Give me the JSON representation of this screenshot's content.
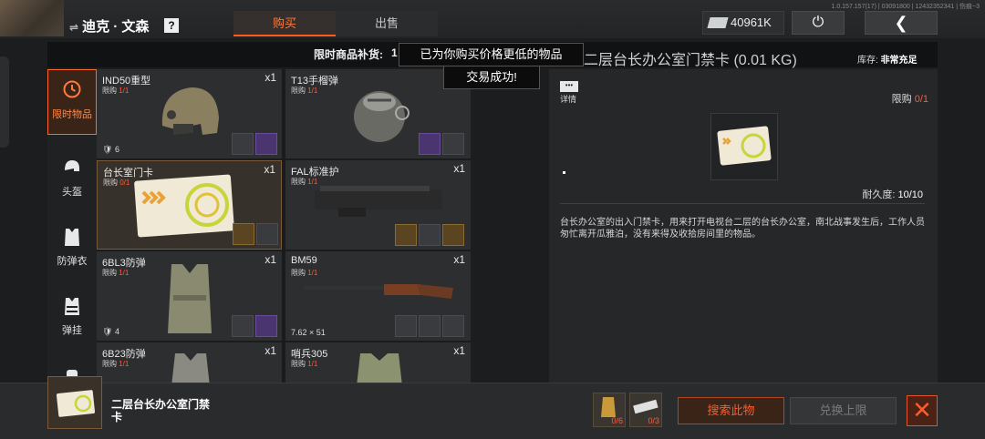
{
  "player": {
    "name": "迪克 · 文森",
    "name_mark": "⇌",
    "help": "?"
  },
  "tabs": {
    "buy": "购买",
    "sell": "出售"
  },
  "version_text": "1.0.157.157(17) | 03091800 | 12432352341 | 伤痕~3",
  "currency": {
    "amount": "40961K"
  },
  "buttons": {
    "power": "⏻",
    "back": "❮"
  },
  "header": {
    "restock_label": "限时商品补货:",
    "restock_value": "1",
    "title": "二层台长办公室门禁卡 (0.01 KG)",
    "stock_label": "库存:",
    "stock_value": "非常充足"
  },
  "toasts": {
    "price": "已为你购买价格更低的物品",
    "success": "交易成功!"
  },
  "categories": [
    {
      "label": "限时物品",
      "icon": "clock-icon",
      "active": true
    },
    {
      "label": "头盔",
      "icon": "helmet-icon",
      "active": false
    },
    {
      "label": "防弹衣",
      "icon": "vest-icon",
      "active": false
    },
    {
      "label": "弹挂",
      "icon": "rig-icon",
      "active": false
    }
  ],
  "items": [
    {
      "name": "IND50重型",
      "limit_label": "限购",
      "limit": "1/1",
      "qty": "x1",
      "armor": "6"
    },
    {
      "name": "T13手榴弹",
      "limit_label": "限购",
      "limit": "1/1",
      "qty": "x1"
    },
    {
      "name": "台长室门卡",
      "limit_label": "限购",
      "limit": "0/1",
      "qty": "x1"
    },
    {
      "name": "FAL标准护",
      "limit_label": "限购",
      "limit": "1/1",
      "qty": "x1"
    },
    {
      "name": "6BL3防弹",
      "limit_label": "限购",
      "limit": "1/1",
      "qty": "x1",
      "armor": "4"
    },
    {
      "name": "BM59",
      "limit_label": "限购",
      "limit": "1/1",
      "qty": "x1",
      "caliber": "7.62 × 51"
    },
    {
      "name": "6B23防弹",
      "limit_label": "限购",
      "limit": "1/1",
      "qty": "x1"
    },
    {
      "name": "哨兵305",
      "limit_label": "限购",
      "limit": "1/1",
      "qty": "x1"
    }
  ],
  "detail": {
    "info_label": "详情",
    "limit_label": "限购",
    "limit_value": "0/1",
    "durability_label": "耐久度:",
    "durability_value": "10/10",
    "description": "台长办公室的出入门禁卡，用来打开电视台二层的台长办公室，南北战事发生后，工作人员匆忙离开瓜雅泊，没有来得及收拾房间里的物品。"
  },
  "bottom": {
    "item_name": "二层台长办公室门禁卡",
    "costs": [
      {
        "count": "0/6"
      },
      {
        "count": "0/3"
      }
    ],
    "search_label": "搜索此物",
    "exchange_label": "兑换上限",
    "close_label": "✕"
  },
  "colors": {
    "accent": "#ff5a1a",
    "limit_red": "#ff5a3a",
    "panel": "#2d2e30"
  }
}
